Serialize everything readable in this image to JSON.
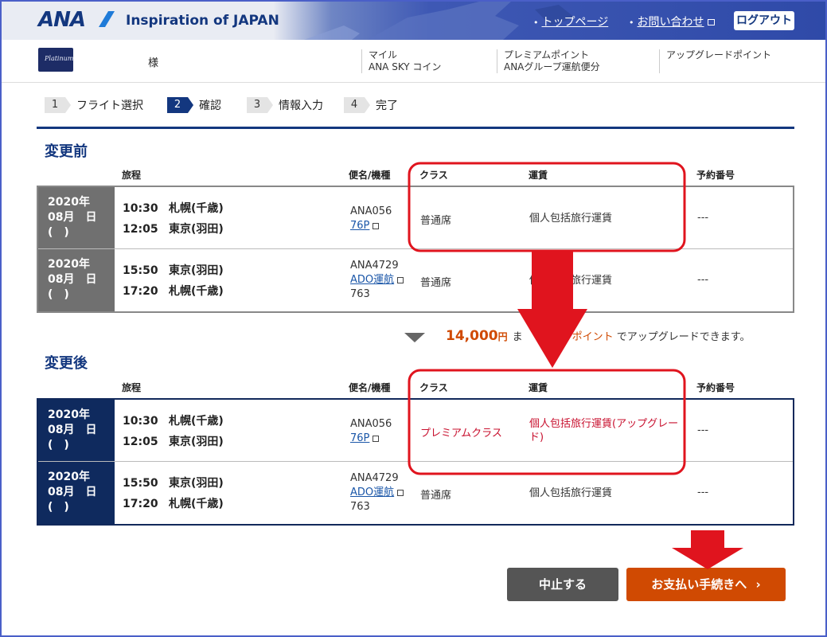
{
  "header": {
    "brand": "ANA",
    "tagline": "Inspiration of JAPAN",
    "nav": {
      "top_page": "トップページ",
      "contact": "お問い合わせ"
    },
    "logout": "ログアウト"
  },
  "member": {
    "card_text": "Platinum",
    "honorific": "様",
    "col1": {
      "line1": "マイル",
      "line2": "ANA SKY コイン"
    },
    "col2": {
      "line1": "プレミアムポイント",
      "line2": "ANAグループ運航便分"
    },
    "col3": {
      "line1": "アップグレードポイント"
    }
  },
  "steps": [
    {
      "num": "1",
      "label": "フライト選択"
    },
    {
      "num": "2",
      "label": "確認"
    },
    {
      "num": "3",
      "label": "情報入力"
    },
    {
      "num": "4",
      "label": "完了"
    }
  ],
  "columns": {
    "itinerary": "旅程",
    "flight": "便名/機種",
    "class": "クラス",
    "fare": "運賃",
    "reservation": "予約番号"
  },
  "before": {
    "title": "変更前",
    "rows": [
      {
        "date_l1": "2020年",
        "date_l2": "08月　日",
        "date_l3": "(　)",
        "dep_time": "10:30",
        "dep_place": "札幌(千歳)",
        "arr_time": "12:05",
        "arr_place": "東京(羽田)",
        "flight_no": "ANA056",
        "aircraft": "76P",
        "aircraft_extra": "",
        "class": "普通席",
        "fare": "個人包括旅行運賃",
        "reservation": "---"
      },
      {
        "date_l1": "2020年",
        "date_l2": "08月　日",
        "date_l3": "(　)",
        "dep_time": "15:50",
        "dep_place": "東京(羽田)",
        "arr_time": "17:20",
        "arr_place": "札幌(千歳)",
        "flight_no": "ANA4729",
        "aircraft": "ADO運航",
        "aircraft_extra": "763",
        "class": "普通席",
        "fare": "個人包括旅行運賃",
        "reservation": "---"
      }
    ]
  },
  "upgrade": {
    "amount": "14,000",
    "unit": "円",
    "middle": "ま",
    "points": "ポイント",
    "suffix": "でアップグレードできます。"
  },
  "after": {
    "title": "変更後",
    "rows": [
      {
        "date_l1": "2020年",
        "date_l2": "08月　日",
        "date_l3": "(　)",
        "dep_time": "10:30",
        "dep_place": "札幌(千歳)",
        "arr_time": "12:05",
        "arr_place": "東京(羽田)",
        "flight_no": "ANA056",
        "aircraft": "76P",
        "aircraft_extra": "",
        "class": "プレミアムクラス",
        "fare": "個人包括旅行運賃(アップグレード)",
        "reservation": "---"
      },
      {
        "date_l1": "2020年",
        "date_l2": "08月　日",
        "date_l3": "(　)",
        "dep_time": "15:50",
        "dep_place": "東京(羽田)",
        "arr_time": "17:20",
        "arr_place": "札幌(千歳)",
        "flight_no": "ANA4729",
        "aircraft": "ADO運航",
        "aircraft_extra": "763",
        "class": "普通席",
        "fare": "個人包括旅行運賃",
        "reservation": "---"
      }
    ]
  },
  "buttons": {
    "cancel": "中止する",
    "proceed": "お支払い手続きへ"
  },
  "colors": {
    "brand_navy": "#13377f",
    "accent_orange": "#d04a02",
    "annotation_red": "#e0141e",
    "upgrade_red": "#c8102e"
  }
}
